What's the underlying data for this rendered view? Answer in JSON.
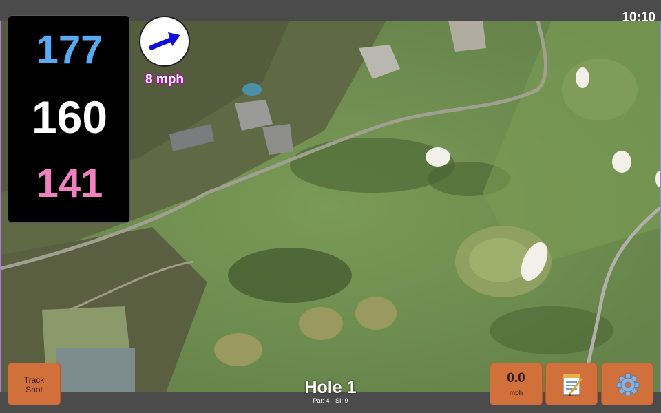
{
  "status": {
    "time": "10:10"
  },
  "distances": {
    "back": "177",
    "middle": "160",
    "front": "141"
  },
  "wind": {
    "speed_label": "8 mph",
    "arrow_color": "#1010d8"
  },
  "hole": {
    "title": "Hole 1",
    "par_label": "Par: 4",
    "si_label": "SI: 9"
  },
  "buttons": {
    "track_shot_line1": "Track",
    "track_shot_line2": "Shot",
    "speed_value": "0.0",
    "speed_unit": "mph",
    "notes_icon": "notepad-icon",
    "settings_icon": "gear-icon"
  },
  "colors": {
    "back": "#5aa9f3",
    "middle": "#ffffff",
    "front": "#f081bf",
    "button": "#d2703b"
  }
}
